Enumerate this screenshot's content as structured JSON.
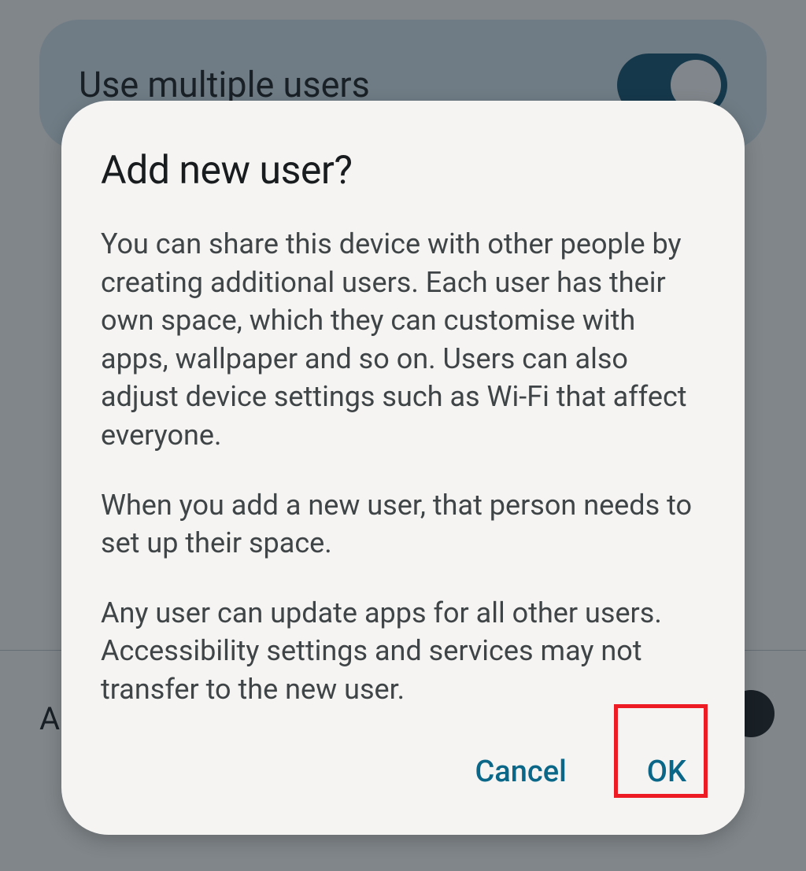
{
  "background": {
    "setting_title": "Use multiple users",
    "toggle_on": true,
    "bottom_letter": "A"
  },
  "dialog": {
    "title": "Add new user?",
    "para1": "You can share this device with other people by creating additional users. Each user has their own space, which they can customise with apps, wallpaper and so on. Users can also adjust device settings such as Wi-Fi that affect everyone.",
    "para2": "When you add a new user, that person needs to set up their space.",
    "para3": "Any user can update apps for all other users. Accessibility settings and services may not transfer to the new user.",
    "cancel_label": "Cancel",
    "ok_label": "OK"
  },
  "annotation": {
    "highlight_target": "ok-button"
  }
}
